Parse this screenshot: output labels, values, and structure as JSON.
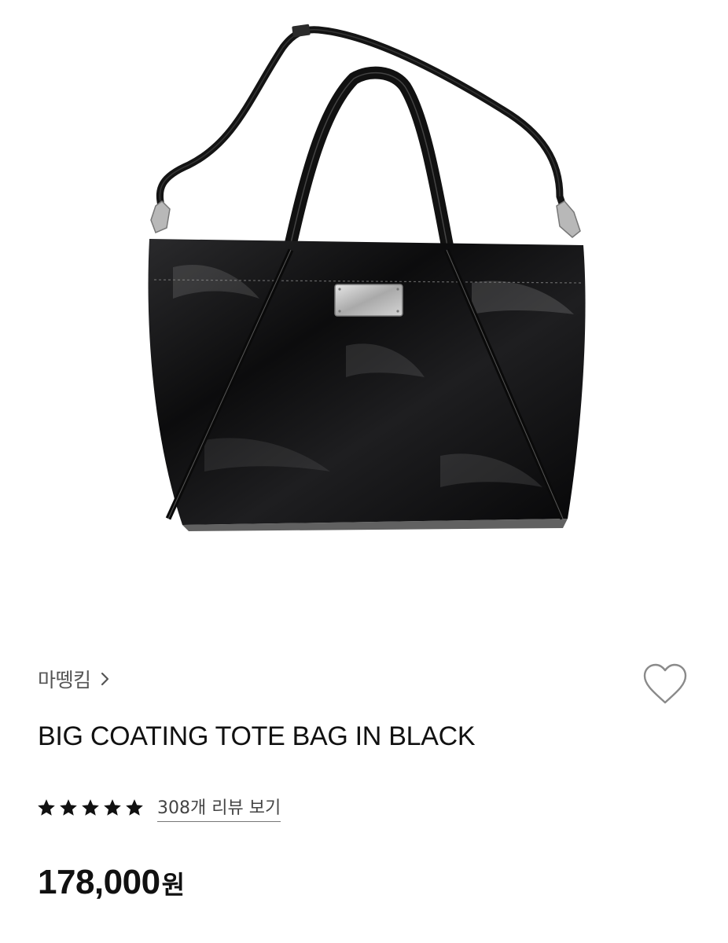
{
  "product": {
    "brand": "마뗑킴",
    "title": "BIG COATING TOTE BAG IN BLACK",
    "rating": 5,
    "rating_max": 5,
    "review_link_label": "308개 리뷰 보기",
    "price_value": "178,000",
    "price_unit": "원"
  },
  "icons": {
    "brand_chevron": "chevron-right-icon",
    "wishlist": "heart-outline-icon",
    "rating_star": "star-filled-icon"
  },
  "colors": {
    "text_primary": "#111111",
    "text_secondary": "#555555",
    "icon_gray": "#8a8a8a",
    "bag_black": "#111111"
  }
}
